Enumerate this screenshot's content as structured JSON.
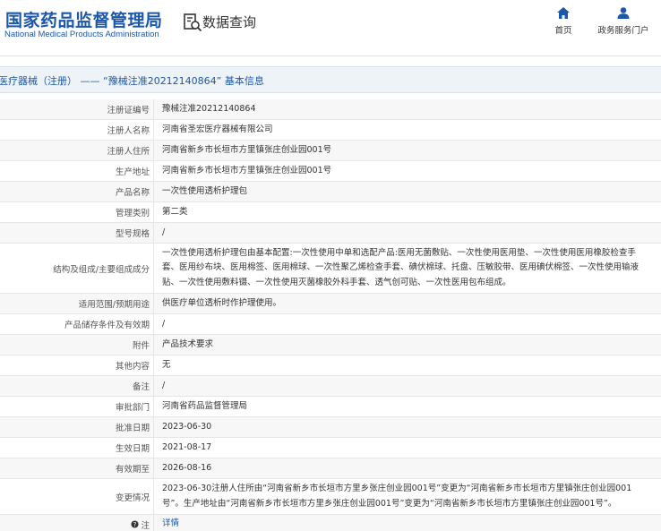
{
  "header": {
    "logo_cn": "国家药品监督管理局",
    "logo_en": "National Medical Products Administration",
    "query_title": "数据查询",
    "nav": {
      "home": "首页",
      "gov": "政务服务门户"
    }
  },
  "title_bar": {
    "text": "医疗器械（注册） —— “豫械注准20212140864” 基本信息"
  },
  "rows": [
    {
      "label": "注册证编号",
      "value": "豫械注准20212140864"
    },
    {
      "label": "注册人名称",
      "value": "河南省圣宏医疗器械有限公司"
    },
    {
      "label": "注册人住所",
      "value": "河南省新乡市长垣市方里镇张庄创业园001号"
    },
    {
      "label": "生产地址",
      "value": "河南省新乡市长垣市方里镇张庄创业园001号"
    },
    {
      "label": "产品名称",
      "value": "一次性使用透析护理包"
    },
    {
      "label": "管理类别",
      "value": "第二类"
    },
    {
      "label": "型号规格",
      "value": "/"
    },
    {
      "label": "结构及组成/主要组成成分",
      "value": "一次性使用透析护理包由基本配置:一次性使用中单和选配产品:医用无菌敷贴、一次性使用医用垫、一次性使用医用橡胶检查手套、医用纱布块、医用棉签、医用棉球、一次性聚乙烯检查手套、碘伏棉球、托盘、压敏胶带、医用碘伏棉签、一次性使用输液贴、一次性使用敷料镊、一次性使用灭菌橡胶外科手套、透气创可贴、一次性医用包布组成。"
    },
    {
      "label": "适用范围/预期用途",
      "value": "供医疗单位透析时作护理使用。"
    },
    {
      "label": "产品储存条件及有效期",
      "value": "/"
    },
    {
      "label": "附件",
      "value": "产品技术要求"
    },
    {
      "label": "其他内容",
      "value": "无"
    },
    {
      "label": "备注",
      "value": "/"
    },
    {
      "label": "审批部门",
      "value": "河南省药品监督管理局"
    },
    {
      "label": "批准日期",
      "value": "2023-06-30"
    },
    {
      "label": "生效日期",
      "value": "2021-08-17"
    },
    {
      "label": "有效期至",
      "value": "2026-08-16"
    },
    {
      "label": "变更情况",
      "value": "2023-06-30注册人住所由“河南省新乡市长垣市方里乡张庄创业园001号”变更为“河南省新乡市长垣市方里镇张庄创业园001号”。生产地址由“河南省新乡市长垣市方里乡张庄创业园001号”变更为“河南省新乡市长垣市方里镇张庄创业园001号”。"
    },
    {
      "label": "注",
      "value": "详情"
    }
  ],
  "colors": {
    "brand_blue": "#1d57a8",
    "title_bar_bg": "#eef3f8",
    "row_alt_bg": "#f7f7f7"
  },
  "icons": {
    "query": "search-document-icon",
    "home": "home-icon",
    "gov": "user-icon",
    "note": "help-icon"
  }
}
